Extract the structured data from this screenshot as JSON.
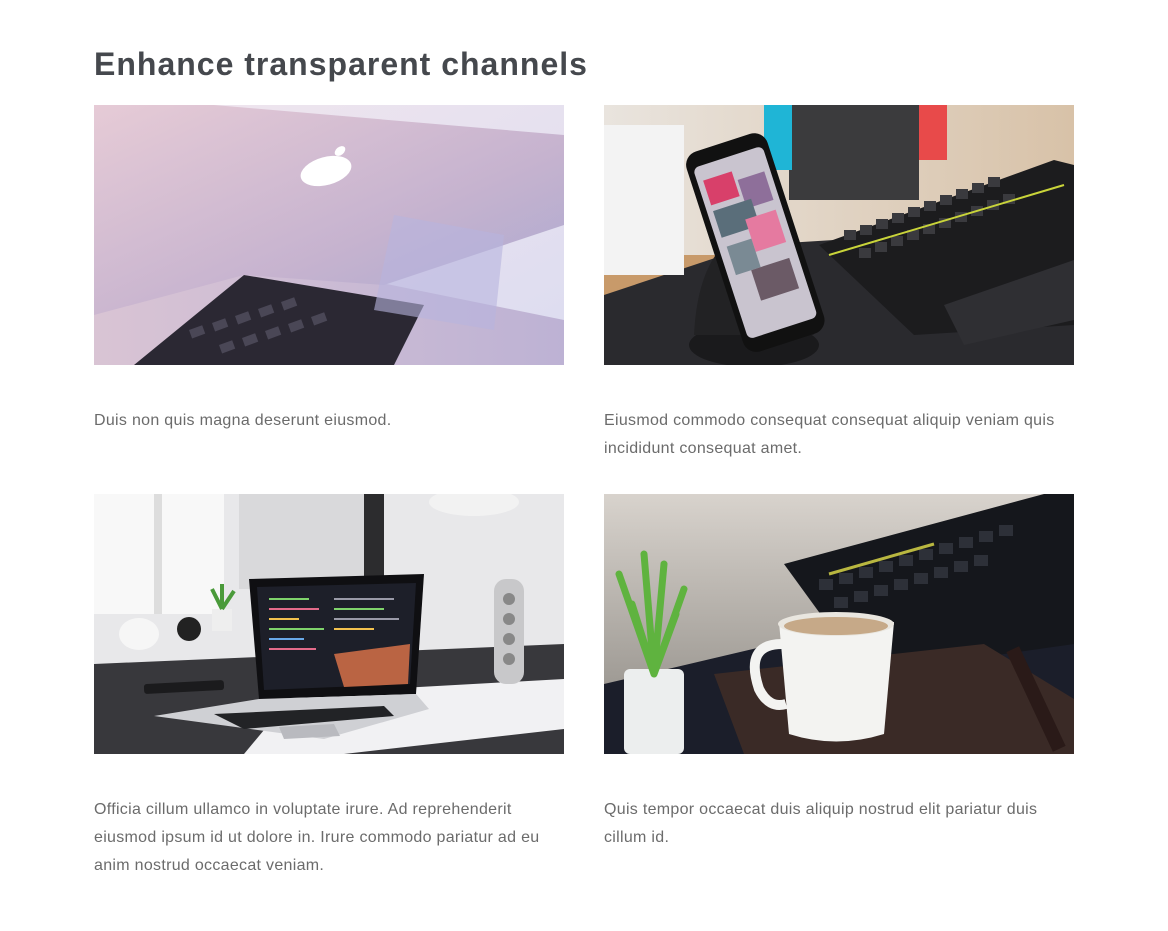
{
  "section": {
    "title": "Enhance transparent channels"
  },
  "cards": [
    {
      "image": "laptop-closeup-photo",
      "caption": "Duis non quis magna deserunt eiusmod."
    },
    {
      "image": "phone-keyboard-desk-photo",
      "caption": "Eiusmod commodo consequat consequat aliquip veniam quis incididunt consequat amet."
    },
    {
      "image": "laptop-code-desk-photo",
      "caption": "Officia cillum ullamco in voluptate irure. Ad reprehenderit eiusmod ipsum id ut dolore in. Irure commodo pariatur ad eu anim nostrud occaecat veniam."
    },
    {
      "image": "coffee-cup-keyboard-photo",
      "caption": "Quis tempor occaecat duis aliquip nostrud elit pariatur duis cillum id."
    }
  ]
}
